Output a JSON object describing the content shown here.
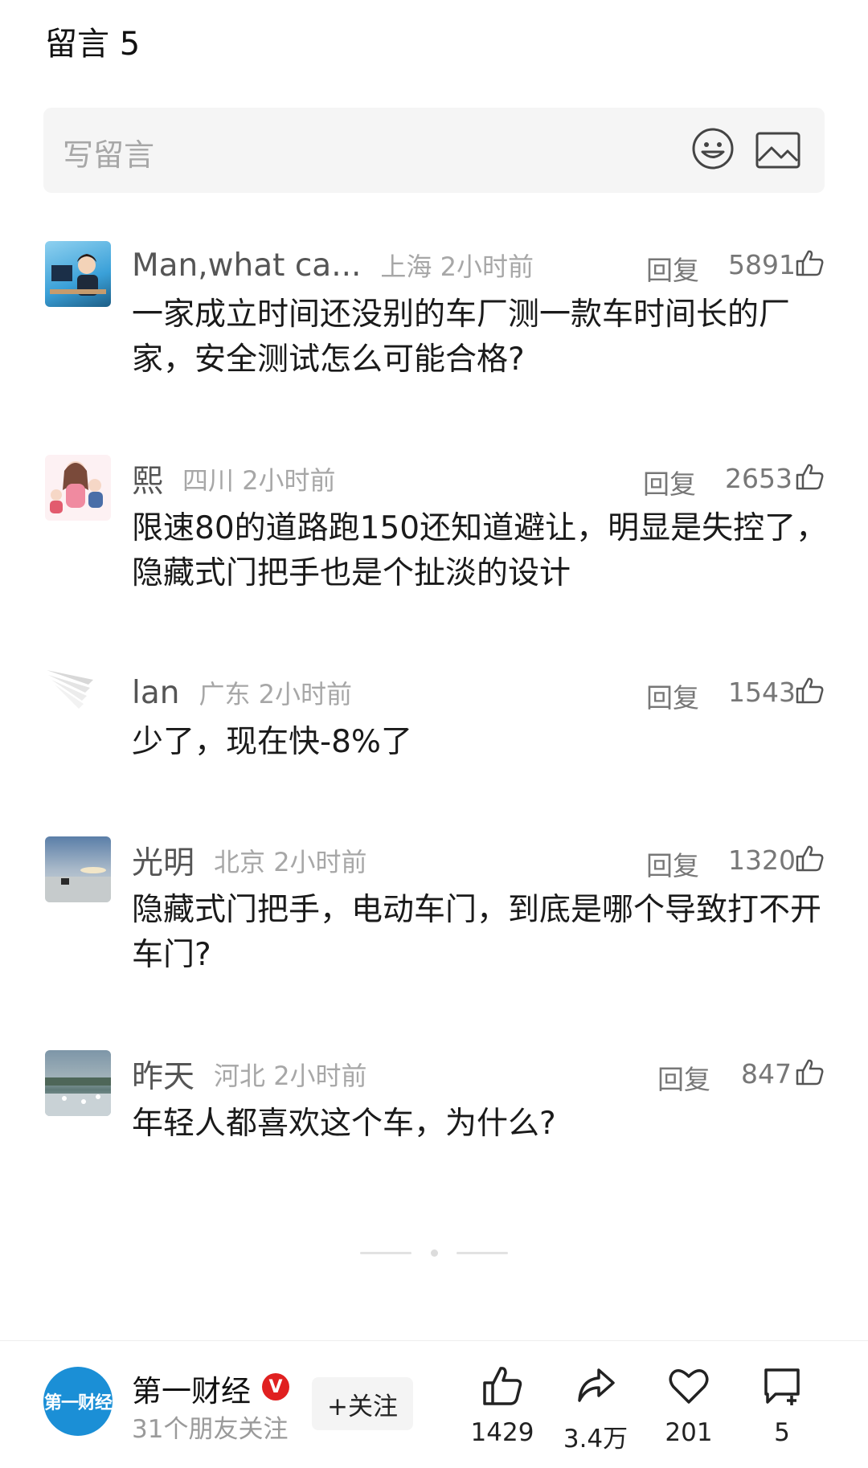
{
  "header": {
    "title": "留言 5"
  },
  "compose": {
    "placeholder": "写留言",
    "emoji_icon": "emoji-icon",
    "image_icon": "image-icon"
  },
  "comments": [
    {
      "username": "Man,what ca...",
      "location": "上海 2小时前",
      "reply_label": "回复",
      "likes": "5891",
      "text": "一家成立时间还没别的车厂测一款车时间长的厂家，安全测试怎么可能合格?"
    },
    {
      "username": "熙",
      "location": "四川 2小时前",
      "reply_label": "回复",
      "likes": "2653",
      "text": "限速80的道路跑150还知道避让，明显是失控了，隐藏式门把手也是个扯淡的设计"
    },
    {
      "username": "lan",
      "location": "广东 2小时前",
      "reply_label": "回复",
      "likes": "1543",
      "text": "少了，现在快-8%了"
    },
    {
      "username": "光明",
      "location": "北京 2小时前",
      "reply_label": "回复",
      "likes": "1320",
      "text": "隐藏式门把手，电动车门，到底是哪个导致打不开车门?"
    },
    {
      "username": "昨天",
      "location": "河北 2小时前",
      "reply_label": "回复",
      "likes": "847",
      "text": "年轻人都喜欢这个车，为什么?"
    }
  ],
  "account": {
    "name": "第一财经",
    "logo_text": "第一财经",
    "verified_mark": "V",
    "followers": "31个朋友关注",
    "follow_label": "+关注"
  },
  "actions": {
    "like_count": "1429",
    "share_count": "3.4万",
    "favorite_count": "201",
    "comment_count": "5"
  },
  "colors": {
    "accent_blue": "#1b8fd6",
    "verified_red": "#e02020",
    "text_gray": "#a7a7a7"
  }
}
